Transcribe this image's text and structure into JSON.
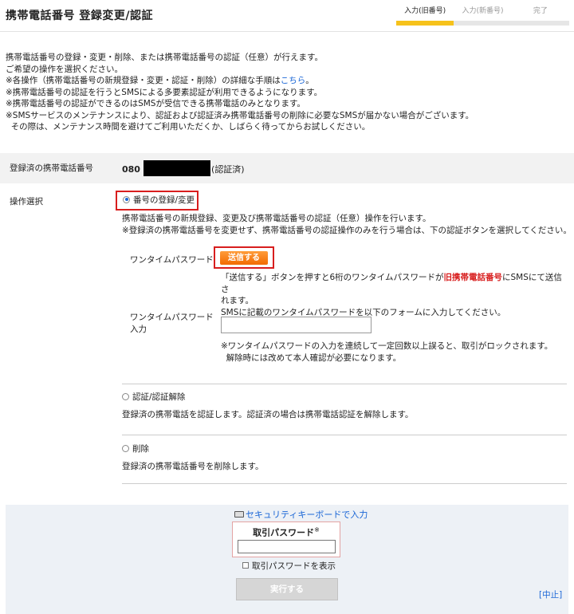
{
  "header": {
    "title": "携帯電話番号 登録変更/認証",
    "steps": [
      "入力(旧番号)",
      "入力(新番号)",
      "完了"
    ]
  },
  "intro": {
    "line1": "携帯電話番号の登録・変更・削除、または携帯電話番号の認証（任意）が行えます。",
    "line2": "ご希望の操作を選択ください。",
    "line3_prefix": "※各操作（携帯電話番号の新規登録・変更・認証・削除）の詳細な手順は",
    "line3_link": "こちら",
    "line3_suffix": "。",
    "line4": "※携帯電話番号の認証を行うとSMSによる多要素認証が利用できるようになります。",
    "line5": "※携帯電話番号の認証ができるのはSMSが受信できる携帯電話のみとなります。",
    "line6": "※SMSサービスのメンテナンスにより、認証および認証済み携帯電話番号の削除に必要なSMSが届かない場合がございます。",
    "line7": "その際は、メンテナンス時間を避けてご利用いただくか、しばらく待ってからお試しください。"
  },
  "registered": {
    "label": "登録済の携帯電話番号",
    "number_prefix": "080",
    "status": "(認証済)"
  },
  "operation": {
    "label": "操作選択",
    "option_register": {
      "label": "番号の登録/変更",
      "desc1": "携帯電話番号の新規登録、変更及び携帯電話番号の認証（任意）操作を行います。",
      "desc2": "※登録済の携帯電話番号を変更せず、携帯電話番号の認証操作のみを行う場合は、下の認証ボタンを選択してください。"
    },
    "otp": {
      "label": "ワンタイムパスワード",
      "send_button": "送信する",
      "help1_prefix": "「送信する」ボタンを押すと6桁のワンタイムパスワードが",
      "help1_red": "旧携帯電話番号",
      "help1_suffix": "にSMSにて送信さ",
      "help2": "れます。",
      "help3": "SMSに記載のワンタイムパスワードを以下のフォームに入力してください。",
      "input_label_1": "ワンタイムパスワード",
      "input_label_2": "入力",
      "lock1": "※ワンタイムパスワードの入力を連続して一定回数以上誤ると、取引がロックされます。",
      "lock2": "解除時には改めて本人確認が必要になります。"
    },
    "option_auth": {
      "label": "認証/認証解除",
      "desc": "登録済の携帯電話を認証します。認証済の場合は携帯電話認証を解除します。"
    },
    "option_delete": {
      "label": "削除",
      "desc": "登録済の携帯電話番号を削除します。"
    }
  },
  "footer": {
    "security_keyboard": "セキュリティキーボードで入力",
    "password_label": "取引パスワード",
    "password_mark": "※",
    "show_password": "取引パスワードを表示",
    "execute_button": "実行する",
    "cancel_link": "[中止]"
  },
  "colors": {
    "accent_step": "#f6c21b",
    "send_button": "#f26b00",
    "highlight_border": "#d81e1e",
    "link": "#1a66d6"
  }
}
